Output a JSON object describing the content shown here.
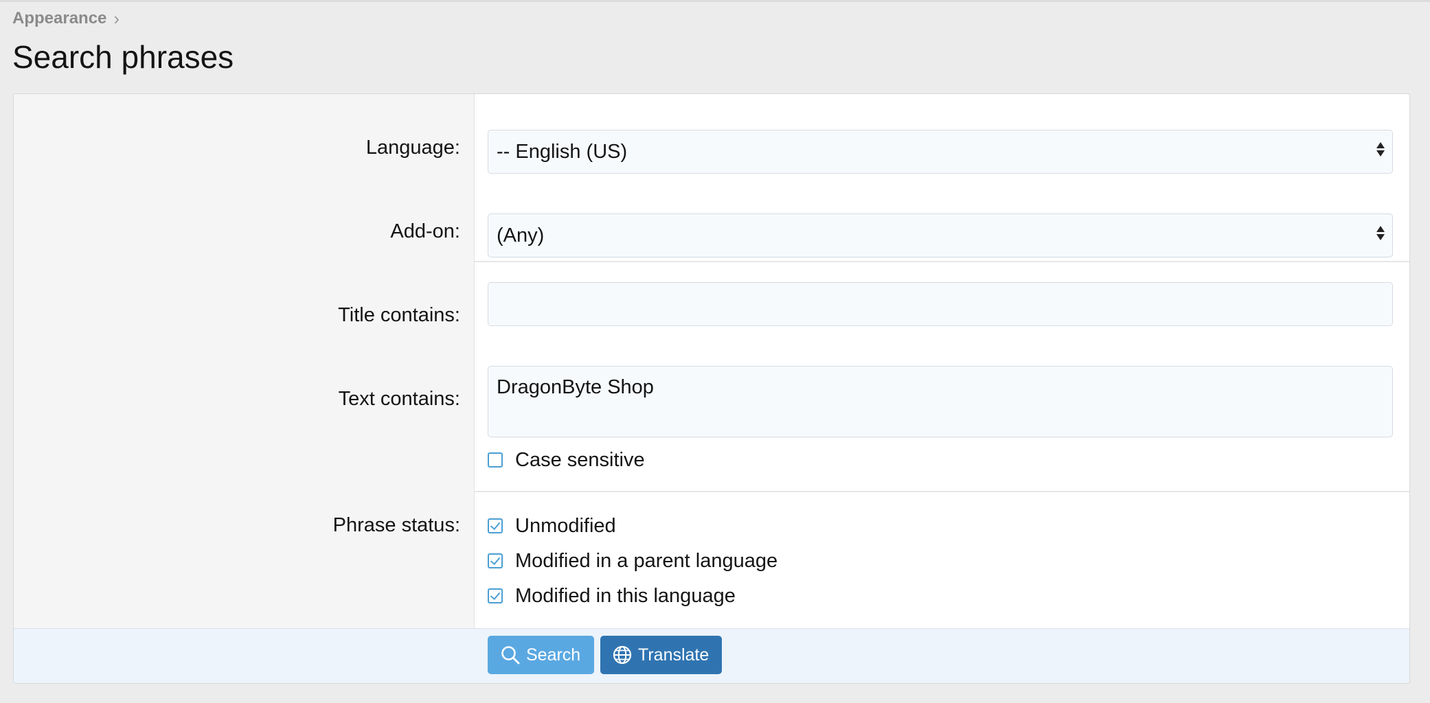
{
  "breadcrumb": {
    "parent": "Appearance",
    "separator": "›"
  },
  "page_title": "Search phrases",
  "form": {
    "language": {
      "label": "Language:",
      "value": "-- English (US)"
    },
    "addon": {
      "label": "Add-on:",
      "value": "(Any)"
    },
    "title_contains": {
      "label": "Title contains:",
      "value": ""
    },
    "text_contains": {
      "label": "Text contains:",
      "value": "DragonByte Shop"
    },
    "case_sensitive": {
      "label": "Case sensitive",
      "checked": false
    },
    "phrase_status": {
      "label": "Phrase status:",
      "options": [
        {
          "label": "Unmodified",
          "checked": true
        },
        {
          "label": "Modified in a parent language",
          "checked": true
        },
        {
          "label": "Modified in this language",
          "checked": true
        }
      ]
    }
  },
  "buttons": {
    "search": {
      "label": "Search",
      "icon": "search-icon"
    },
    "translate": {
      "label": "Translate",
      "icon": "globe-icon"
    }
  },
  "colors": {
    "accent": "#5aa8e2",
    "primary_dark": "#2f74b1",
    "checkbox": "#4a9fd4"
  }
}
